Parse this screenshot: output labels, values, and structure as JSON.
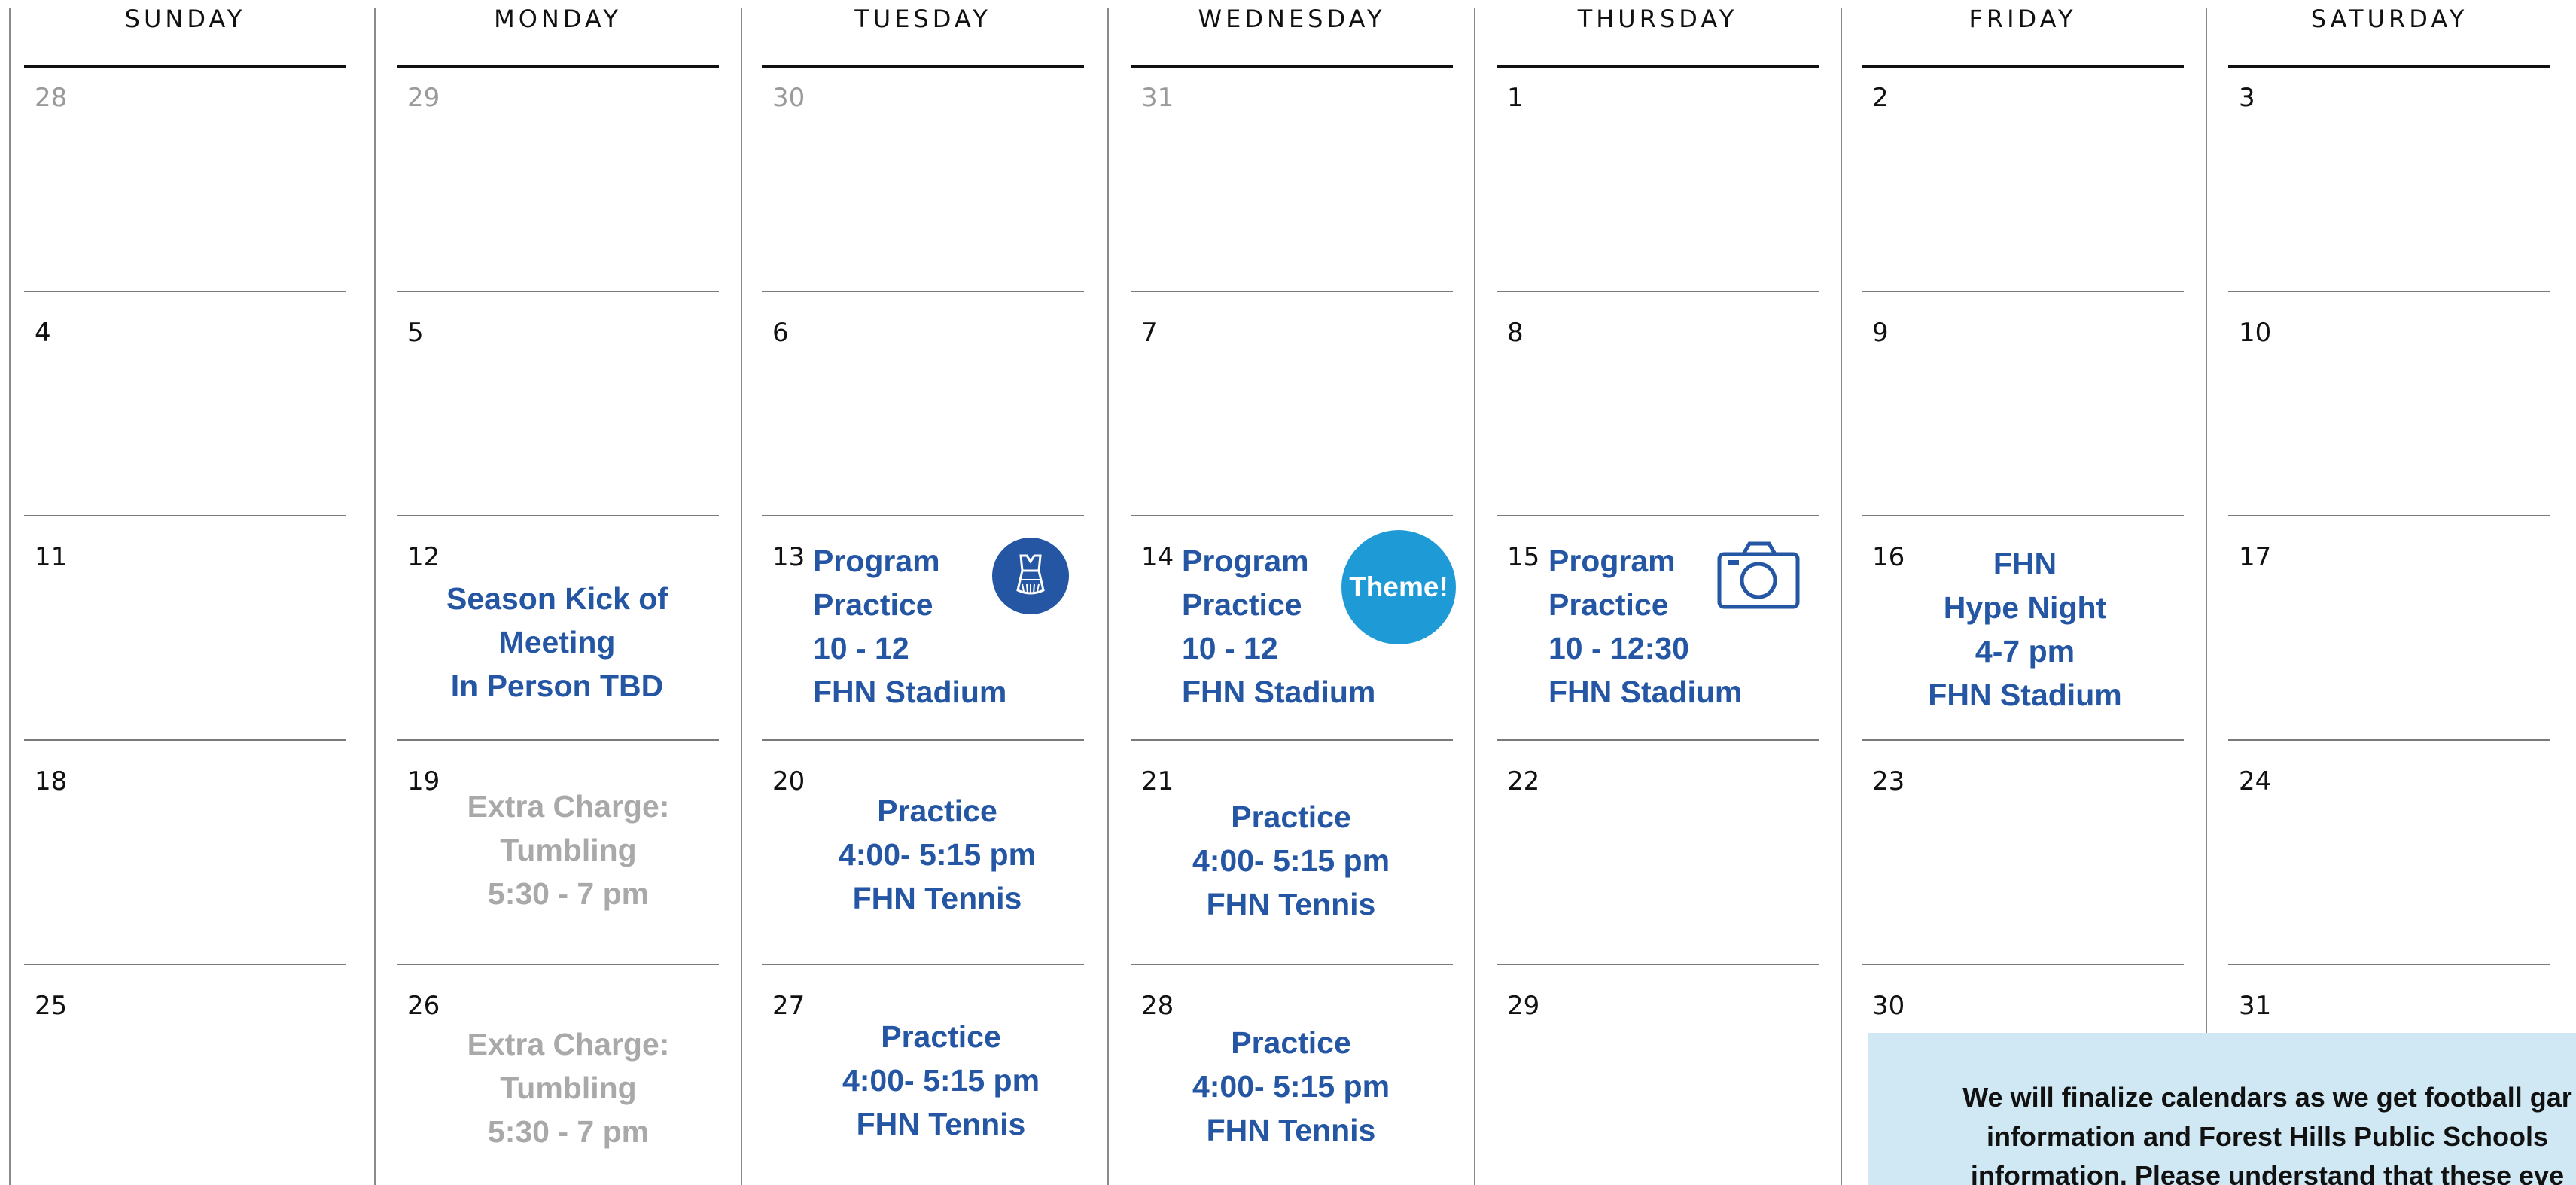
{
  "weekdays": [
    "SUNDAY",
    "MONDAY",
    "TUESDAY",
    "WEDNESDAY",
    "THURSDAY",
    "FRIDAY",
    "SATURDAY"
  ],
  "weeks": [
    [
      "28",
      "29",
      "30",
      "31",
      "1",
      "2",
      "3"
    ],
    [
      "4",
      "5",
      "6",
      "7",
      "8",
      "9",
      "10"
    ],
    [
      "11",
      "12",
      "13",
      "14",
      "15",
      "16",
      "17"
    ],
    [
      "18",
      "19",
      "20",
      "21",
      "22",
      "23",
      "24"
    ],
    [
      "25",
      "26",
      "27",
      "28",
      "29",
      "30",
      "31"
    ]
  ],
  "events": {
    "kickoff": [
      "Season Kick of",
      "Meeting",
      "In Person TBD"
    ],
    "program_13": [
      "Program",
      "Practice",
      "10 - 12",
      "FHN Stadium"
    ],
    "program_14": [
      "Program",
      "Practice",
      "10 - 12",
      "FHN Stadium"
    ],
    "program_15": [
      "Program",
      "Practice",
      "10 - 12:30",
      "FHN Stadium"
    ],
    "hype_night": [
      "FHN",
      "Hype Night",
      "4-7 pm",
      "FHN Stadium"
    ],
    "tumbling_19": [
      "Extra Charge:",
      "Tumbling",
      "5:30 - 7 pm"
    ],
    "practice_20": [
      "Practice",
      "4:00- 5:15 pm",
      "FHN Tennis"
    ],
    "practice_21": [
      "Practice",
      "4:00- 5:15 pm",
      "FHN Tennis"
    ],
    "tumbling_26": [
      "Extra Charge:",
      "Tumbling",
      "5:30 - 7 pm"
    ],
    "practice_27": [
      "Practice",
      "4:00- 5:15 pm",
      "FHN Tennis"
    ],
    "practice_28": [
      "Practice",
      "4:00- 5:15 pm",
      "FHN Tennis"
    ]
  },
  "badges": {
    "theme_label": "Theme!",
    "uniform_icon": "cheer-uniform-icon",
    "camera_icon": "camera-icon"
  },
  "note": {
    "lines": [
      "We will finalize calendars as we get football gar",
      "information and Forest Hills Public Schools",
      "information. Please understand that these eve"
    ]
  },
  "colors": {
    "event_blue": "#2456a4",
    "muted_grey": "#a9a9a9",
    "theme_badge": "#1e9ad6",
    "note_background": "#cfe8f4"
  }
}
